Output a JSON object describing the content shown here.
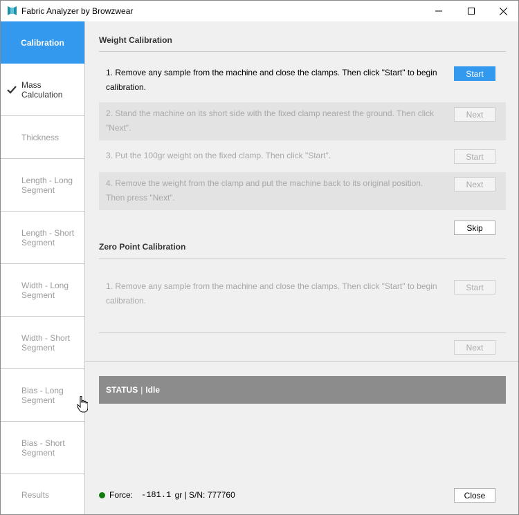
{
  "window": {
    "title": "Fabric Analyzer by Browzwear",
    "icon": "fabric-analyzer-logo-icon"
  },
  "sidebar": {
    "items": [
      {
        "label": "Calibration",
        "state": "active"
      },
      {
        "label": "Mass Calculation",
        "state": "done"
      },
      {
        "label": "Thickness",
        "state": "pending"
      },
      {
        "label": "Length - Long Segment",
        "state": "pending"
      },
      {
        "label": "Length - Short Segment",
        "state": "pending"
      },
      {
        "label": "Width - Long Segment",
        "state": "pending"
      },
      {
        "label": "Width - Short Segment",
        "state": "pending"
      },
      {
        "label": "Bias - Long Segment",
        "state": "pending"
      },
      {
        "label": "Bias - Short Segment",
        "state": "pending"
      },
      {
        "label": "Results",
        "state": "pending"
      }
    ]
  },
  "weight_calibration": {
    "title": "Weight Calibration",
    "steps": [
      {
        "number": "1.",
        "text": "Remove any sample from the machine and close the clamps. Then click \"Start\" to begin calibration.",
        "button": "Start",
        "enabled": true
      },
      {
        "number": "2.",
        "text": "Stand the machine on its short side with the fixed clamp nearest the ground. Then click \"Next\".",
        "button": "Next",
        "enabled": false
      },
      {
        "number": "3.",
        "text": "Put the 100gr weight on the fixed clamp. Then click \"Start\".",
        "button": "Start",
        "enabled": false
      },
      {
        "number": "4.",
        "text": "Remove the weight from the clamp and put the machine back to its original position. Then press \"Next\".",
        "button": "Next",
        "enabled": false
      }
    ],
    "skip_label": "Skip"
  },
  "zero_point_calibration": {
    "title": "Zero Point Calibration",
    "steps": [
      {
        "number": "1.",
        "text": "Remove any sample from the machine and close the clamps. Then click \"Start\" to begin calibration.",
        "button": "Start",
        "enabled": false
      }
    ],
    "next_label": "Next"
  },
  "status": {
    "label": "STATUS",
    "separator": "|",
    "value": "Idle"
  },
  "footer": {
    "force_label": "Force:",
    "force_value": "-181.1",
    "force_unit_serial": "gr | S/N: 777760",
    "close_label": "Close",
    "led_color": "#107c10"
  },
  "colors": {
    "accent": "#3399ee",
    "status_bar": "#8c8c8c"
  }
}
